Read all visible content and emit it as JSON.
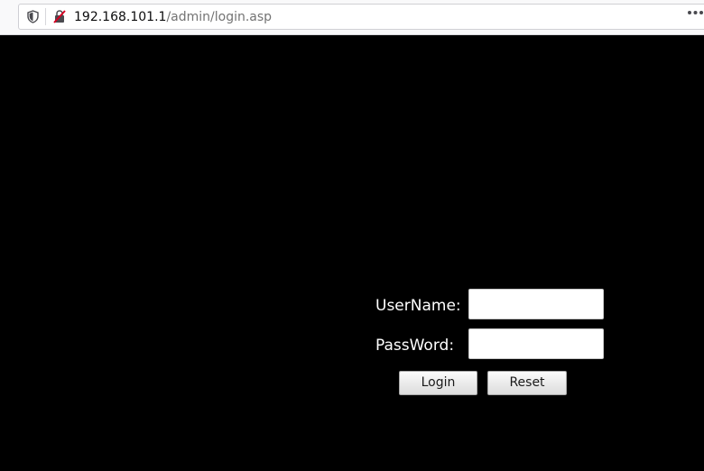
{
  "browser": {
    "url_host": "192.168.101.1",
    "url_path": "/admin/login.asp",
    "icons": [
      "shield-icon",
      "insecure-lock-icon",
      "more-options-icon"
    ]
  },
  "login_form": {
    "username_label": "UserName:",
    "username_value": "",
    "password_label": "PassWord:",
    "password_value": "",
    "login_button": "Login",
    "reset_button": "Reset"
  },
  "colors": {
    "page_background": "#000000",
    "label_text": "#ffffff",
    "insecure_icon": "#d70022"
  }
}
